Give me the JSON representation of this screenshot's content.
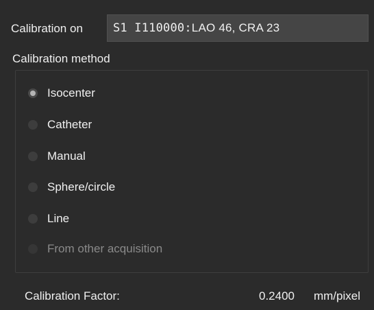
{
  "calibration_on": {
    "label": "Calibration on",
    "acquisition_id": "S1 I110000:",
    "acquisition_view": " LAO 46, CRA 23"
  },
  "calibration_method": {
    "label": "Calibration method",
    "selected": "Isocenter",
    "options": [
      {
        "label": "Isocenter",
        "checked": true,
        "enabled": true
      },
      {
        "label": "Catheter",
        "checked": false,
        "enabled": true
      },
      {
        "label": "Manual",
        "checked": false,
        "enabled": true
      },
      {
        "label": "Sphere/circle",
        "checked": false,
        "enabled": true
      },
      {
        "label": "Line",
        "checked": false,
        "enabled": true
      },
      {
        "label": "From other acquisition",
        "checked": false,
        "enabled": false
      }
    ]
  },
  "calibration_factor": {
    "label": "Calibration Factor:",
    "value": "0.2400",
    "unit": "mm/pixel"
  },
  "colors": {
    "background": "#2b2b2b",
    "field_background": "#454545",
    "text": "#f0f0f0",
    "disabled_text": "#8a8a8a",
    "radio_checked_dot": "#b4b4b4"
  }
}
